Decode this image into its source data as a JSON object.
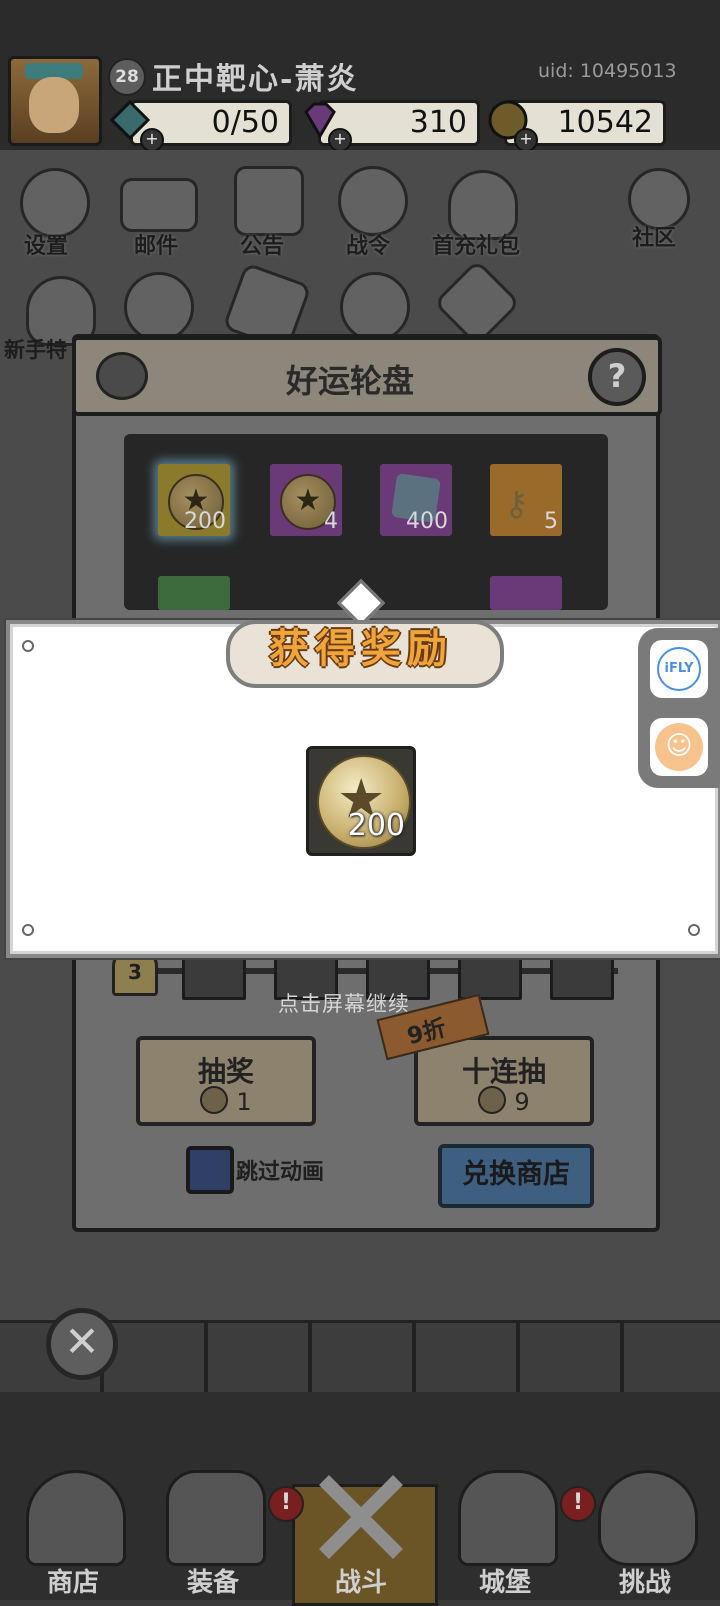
{
  "player": {
    "level": "28",
    "name": "正中靶心-萧炎",
    "uid": "uid: 10495013"
  },
  "resources": {
    "energy": "0/50",
    "gems": "310",
    "gold": "10542",
    "plus": "+"
  },
  "menu": {
    "items": [
      "设置",
      "邮件",
      "公告",
      "战令",
      "首充礼包",
      "社区"
    ],
    "side_label": "新手特"
  },
  "wheel": {
    "title": "好运轮盘",
    "help": "?",
    "tiles": [
      {
        "count": "200",
        "icon": "coin-icon",
        "color": "#8c7a2c"
      },
      {
        "count": "4",
        "icon": "coin-icon",
        "color": "#6a3a78"
      },
      {
        "count": "400",
        "icon": "gem-icon",
        "color": "#6a3a78"
      },
      {
        "count": "5",
        "icon": "key-icon",
        "color": "#9a6a2a"
      }
    ],
    "progress_level": "3",
    "continue_hint": "点击屏幕继续",
    "draw_one": {
      "label": "抽奖",
      "cost": "1"
    },
    "draw_ten": {
      "label": "十连抽",
      "cost": "9"
    },
    "discount": "9折",
    "skip_label": "跳过动画",
    "shop_label": "兑换商店"
  },
  "reward": {
    "title": "获得奖励",
    "item_count": "200",
    "item_icon": "star-coin-icon"
  },
  "side_tools": {
    "ifly": "iFLY",
    "accessibility_icon": "accessibility-icon"
  },
  "close_label": "✕",
  "nav": {
    "items": [
      "商店",
      "装备",
      "战斗",
      "城堡",
      "挑战"
    ],
    "badge": "!"
  },
  "colors": {
    "reward_title": "#f0a53a",
    "energy": "#3fa0a0",
    "gems": "#b45ad0",
    "gold": "#d6a926"
  }
}
